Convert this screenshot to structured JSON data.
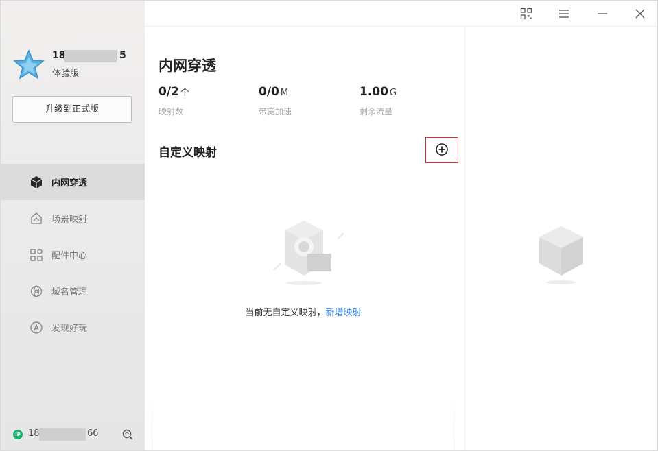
{
  "user": {
    "phone_prefix": "18",
    "phone_suffix": "5",
    "plan": "体验版",
    "upgrade_label": "升级到正式版"
  },
  "nav": {
    "items": [
      {
        "label": "内网穿透",
        "icon": "cube-icon",
        "active": true
      },
      {
        "label": "场景映射",
        "icon": "scene-map-icon",
        "active": false
      },
      {
        "label": "配件中心",
        "icon": "grid-apps-icon",
        "active": false
      },
      {
        "label": "域名管理",
        "icon": "domain-globe-icon",
        "active": false
      },
      {
        "label": "发现好玩",
        "icon": "compass-icon",
        "active": false
      }
    ]
  },
  "footer": {
    "ip_badge": "IP",
    "ip_prefix": "18",
    "ip_suffix": "66"
  },
  "titlebar": {
    "icons": [
      "qr-code-icon",
      "menu-icon",
      "minimize-icon",
      "close-icon"
    ]
  },
  "main": {
    "title": "内网穿透",
    "stats": [
      {
        "value": "0/2",
        "unit": "个",
        "label": "映射数"
      },
      {
        "value": "0/0",
        "unit": "M",
        "label": "带宽加速"
      },
      {
        "value": "1.00",
        "unit": "G",
        "label": "剩余流量"
      }
    ],
    "section_title": "自定义映射",
    "empty_text": "当前无自定义映射，",
    "empty_link": "新增映射"
  },
  "colors": {
    "accent_link": "#2a7fe0",
    "highlight_border": "#e52b2b",
    "ip_badge": "#17b36b",
    "avatar_star": "#4aa3d8"
  }
}
